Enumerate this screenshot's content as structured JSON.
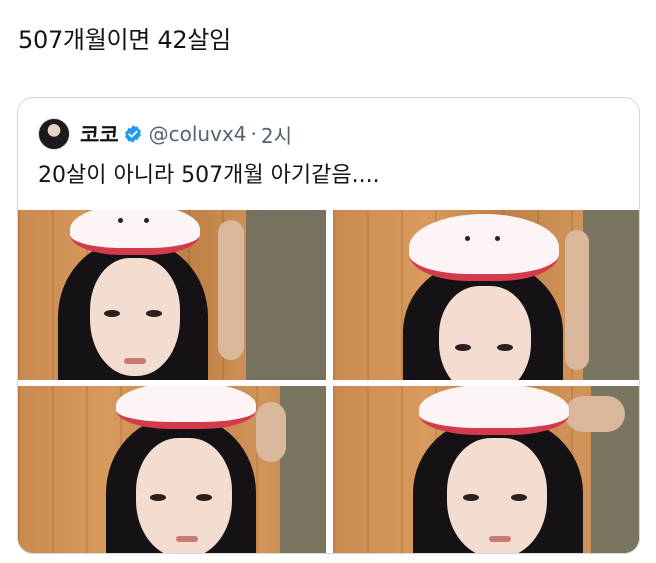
{
  "post": {
    "text": "507개월이면 42살임"
  },
  "quote": {
    "display_name": "코코",
    "handle": "@coluvx4",
    "separator": "·",
    "time": "2시",
    "text": "20살이 아니라 507개월 아기같음....",
    "verified_color": "#1d9bf0"
  },
  "media": {
    "photo_count": 4
  }
}
